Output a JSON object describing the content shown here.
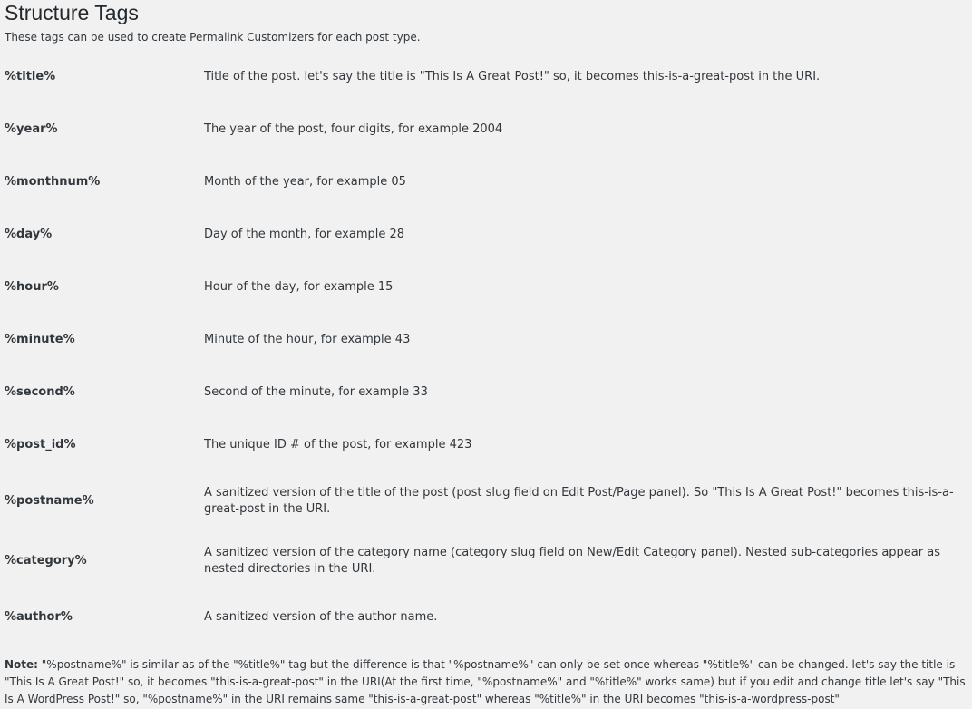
{
  "header": {
    "title": "Structure Tags",
    "intro": "These tags can be used to create Permalink Customizers for each post type."
  },
  "tags": [
    {
      "tag": "%title%",
      "desc": "Title of the post. let's say the title is \"This Is A Great Post!\" so, it becomes this-is-a-great-post in the URI."
    },
    {
      "tag": "%year%",
      "desc": "The year of the post, four digits, for example 2004"
    },
    {
      "tag": "%monthnum%",
      "desc": "Month of the year, for example 05"
    },
    {
      "tag": "%day%",
      "desc": "Day of the month, for example 28"
    },
    {
      "tag": "%hour%",
      "desc": "Hour of the day, for example 15"
    },
    {
      "tag": "%minute%",
      "desc": "Minute of the hour, for example 43"
    },
    {
      "tag": "%second%",
      "desc": "Second of the minute, for example 33"
    },
    {
      "tag": "%post_id%",
      "desc": "The unique ID # of the post, for example 423"
    },
    {
      "tag": "%postname%",
      "desc": "A sanitized version of the title of the post (post slug field on Edit Post/Page panel). So \"This Is A Great Post!\" becomes this-is-a-great-post in the URI."
    },
    {
      "tag": "%category%",
      "desc": "A sanitized version of the category name (category slug field on New/Edit Category panel). Nested sub-categories appear as nested directories in the URI."
    },
    {
      "tag": "%author%",
      "desc": "A sanitized version of the author name."
    }
  ],
  "note": {
    "label": "Note:",
    "text": " \"%postname%\" is similar as of the \"%title%\" tag but the difference is that \"%postname%\" can only be set once whereas \"%title%\" can be changed. let's say the title is \"This Is A Great Post!\" so, it becomes \"this-is-a-great-post\" in the URI(At the first time, \"%postname%\" and \"%title%\" works same) but if you edit and change title let's say \"This Is A WordPress Post!\" so, \"%postname%\" in the URI remains same \"this-is-a-great-post\" whereas \"%title%\" in the URI becomes \"this-is-a-wordpress-post\""
  }
}
